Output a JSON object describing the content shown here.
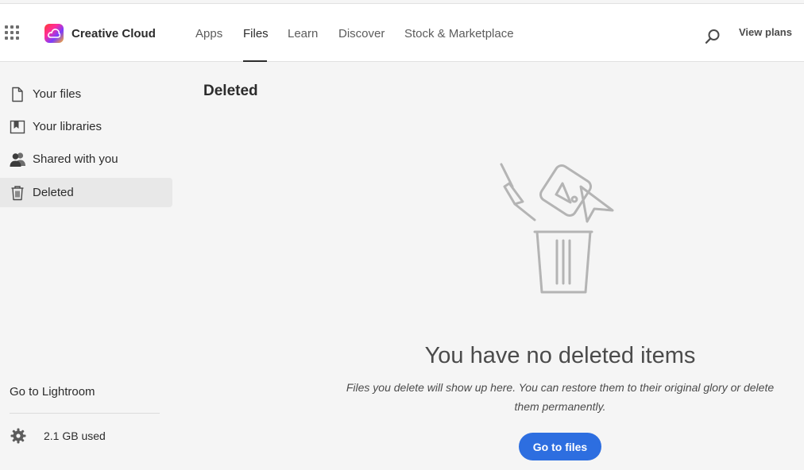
{
  "app": {
    "title": "Creative Cloud"
  },
  "nav": {
    "tabs": [
      {
        "label": "Apps"
      },
      {
        "label": "Files"
      },
      {
        "label": "Learn"
      },
      {
        "label": "Discover"
      },
      {
        "label": "Stock & Marketplace"
      }
    ],
    "active_tab": "Files",
    "view_plans": "View plans"
  },
  "sidebar": {
    "items": [
      {
        "label": "Your files",
        "icon": "document-icon"
      },
      {
        "label": "Your libraries",
        "icon": "library-icon"
      },
      {
        "label": "Shared with you",
        "icon": "shared-users-icon"
      },
      {
        "label": "Deleted",
        "icon": "trash-icon",
        "active": true
      }
    ],
    "lightroom_link": "Go to Lightroom",
    "storage": "2.1 GB used"
  },
  "main": {
    "title": "Deleted",
    "empty_state": {
      "heading": "You have no deleted items",
      "description": "Files you delete will show up here. You can restore them to their original glory or delete them permanently.",
      "button": "Go to files"
    }
  },
  "colors": {
    "accent": "#2d6ee0",
    "background": "#f5f5f5",
    "topbar": "#ffffff",
    "active_item": "#e8e8e8"
  }
}
